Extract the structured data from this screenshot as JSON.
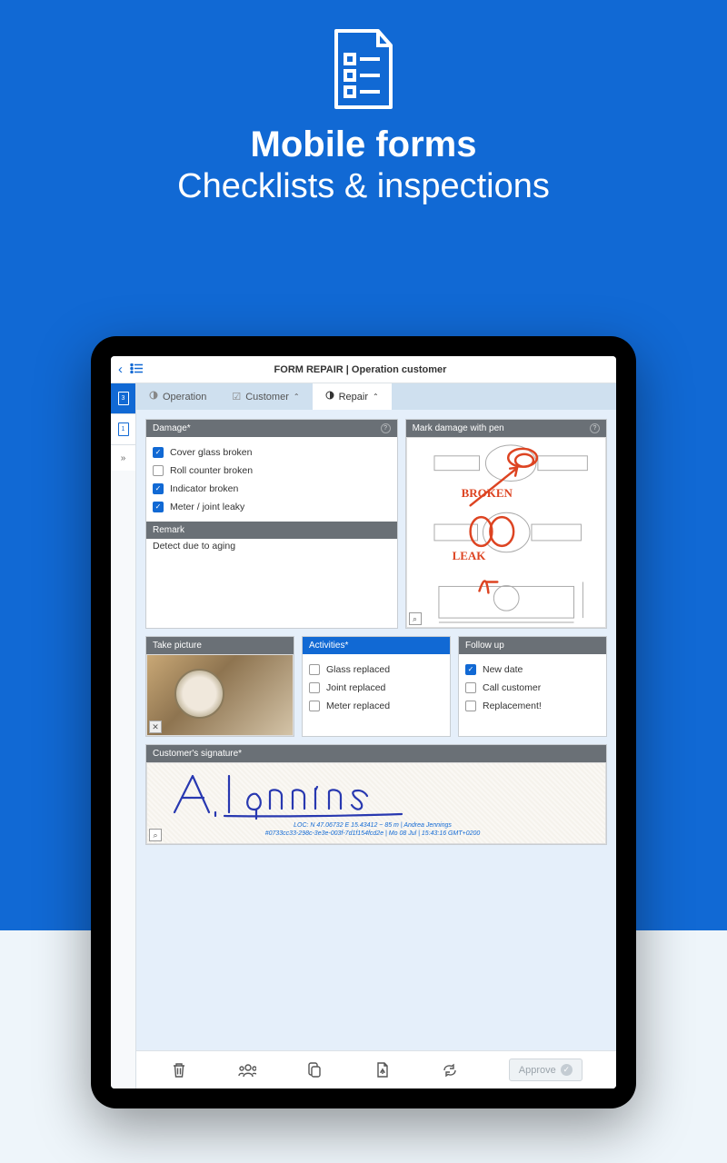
{
  "hero": {
    "title": "Mobile forms",
    "subtitle": "Checklists & inspections"
  },
  "topbar": {
    "title": "FORM REPAIR | Operation customer"
  },
  "rail": {
    "items": [
      "3",
      "1"
    ]
  },
  "tabs": [
    {
      "label": "Operation"
    },
    {
      "label": "Customer"
    },
    {
      "label": "Repair"
    }
  ],
  "damage": {
    "title": "Damage*",
    "items": [
      {
        "label": "Cover glass broken",
        "checked": true
      },
      {
        "label": "Roll counter broken",
        "checked": false
      },
      {
        "label": "Indicator broken",
        "checked": true
      },
      {
        "label": "Meter / joint leaky",
        "checked": true
      }
    ]
  },
  "mark": {
    "title": "Mark damage with pen",
    "ann1": "BROKEN",
    "ann2": "LEAK"
  },
  "remark": {
    "title": "Remark",
    "text": "Detect due to aging"
  },
  "picture": {
    "title": "Take picture"
  },
  "activities": {
    "title": "Activities*",
    "items": [
      {
        "label": "Glass replaced",
        "checked": false
      },
      {
        "label": "Joint replaced",
        "checked": false
      },
      {
        "label": "Meter replaced",
        "checked": false
      }
    ]
  },
  "followup": {
    "title": "Follow up",
    "items": [
      {
        "label": "New date",
        "checked": true
      },
      {
        "label": "Call customer",
        "checked": false
      },
      {
        "label": "Replacement!",
        "checked": false
      }
    ]
  },
  "signature": {
    "title": "Customer's signature*",
    "meta1": "LOC: N 47.06732  E 15.43412  ~ 85 m | Andrea Jennings",
    "meta2": "#0733cc33-298c-3e3e-003f-7d1f154fcd2e | Mo 08 Jul | 15:43:16 GMT+0200"
  },
  "approve": "Approve"
}
